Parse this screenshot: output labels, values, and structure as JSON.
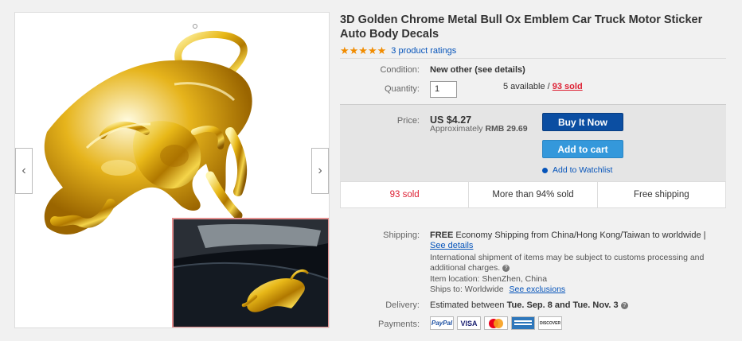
{
  "title": "3D Golden Chrome Metal Bull Ox Emblem Car Truck Motor Sticker Auto Body Decals",
  "rating": {
    "stars": "★★★★★",
    "value": 5,
    "count_text": "3 product ratings"
  },
  "condition": {
    "label": "Condition:",
    "value": "New other (see details)"
  },
  "quantity": {
    "label": "Quantity:",
    "value": "1",
    "available": "5 available / ",
    "sold_link": "93 sold"
  },
  "price": {
    "label": "Price:",
    "value": "US $4.27",
    "approx_prefix": "Approximately",
    "approx_value": "RMB 29.69"
  },
  "buttons": {
    "buy_now": "Buy It Now",
    "add_to_cart": "Add to cart",
    "watchlist": "Add to Watchlist"
  },
  "stats": [
    "93 sold",
    "More than 94% sold",
    "Free shipping"
  ],
  "shipping": {
    "label": "Shipping:",
    "free": "FREE",
    "text": "Economy Shipping from China/Hong Kong/Taiwan to worldwide |",
    "details_link": "See details",
    "intl_note": "International shipment of items may be subject to customs processing and additional charges.",
    "location": "Item location:  ShenZhen, China",
    "ships_to": "Ships to:  Worldwide",
    "exclusions_link": "See exclusions"
  },
  "delivery": {
    "label": "Delivery:",
    "prefix": "Estimated between",
    "range": "Tue. Sep. 8 and Tue. Nov. 3"
  },
  "payments": {
    "label": "Payments:",
    "methods": [
      "PayPal",
      "VISA",
      "MasterCard",
      "AMEX",
      "DISCOVER"
    ]
  },
  "icons": {
    "prev": "chevron-left-icon",
    "next": "chevron-right-icon",
    "help": "help-icon",
    "watch": "eye-icon"
  },
  "colors": {
    "accent_blue": "#0654ba",
    "buy_now": "#0b4ea2",
    "add_to_cart": "#3498db",
    "sold_red": "#dd1e31",
    "stars": "#f18c00"
  }
}
